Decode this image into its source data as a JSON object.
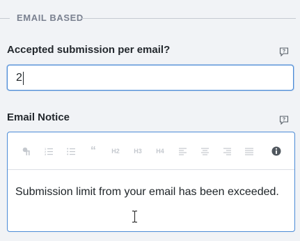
{
  "section": {
    "title": "EMAIL BASED"
  },
  "accepted_field": {
    "label": "Accepted submission per email?",
    "value": "2"
  },
  "notice_field": {
    "label": "Email Notice",
    "content": "Submission limit from your email has been exceeded."
  },
  "toolbar": {
    "h2": "H2",
    "h3": "H3",
    "h4": "H4",
    "items": [
      "paragraph-icon",
      "ordered-list-icon",
      "unordered-list-icon",
      "quote-icon",
      "heading-2",
      "heading-3",
      "heading-4",
      "align-left-icon",
      "align-center-icon",
      "align-right-icon",
      "align-justify-icon",
      "info-icon"
    ]
  },
  "colors": {
    "accent": "#4a8ad6",
    "background": "#f1f3f6",
    "muted": "#c4c8ce"
  }
}
